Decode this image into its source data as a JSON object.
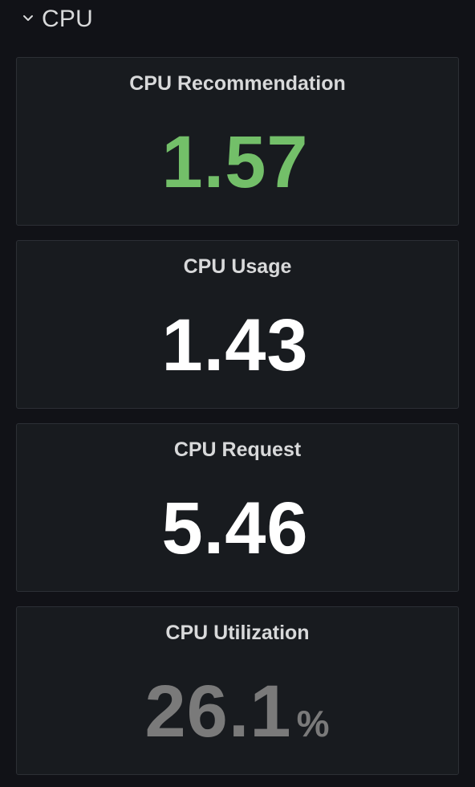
{
  "row": {
    "title": "CPU",
    "icon": "chevron-down-icon"
  },
  "colors": {
    "green": "#73bf69",
    "white": "#ffffff",
    "gray": "#7a7a7a",
    "text": "#d8d9da"
  },
  "panels": [
    {
      "title": "CPU Recommendation",
      "value": "1.57",
      "unit": "",
      "color": "#73bf69"
    },
    {
      "title": "CPU Usage",
      "value": "1.43",
      "unit": "",
      "color": "#ffffff"
    },
    {
      "title": "CPU Request",
      "value": "5.46",
      "unit": "",
      "color": "#ffffff"
    },
    {
      "title": "CPU Utilization",
      "value": "26.1",
      "unit": "%",
      "color": "#7a7a7a"
    }
  ]
}
